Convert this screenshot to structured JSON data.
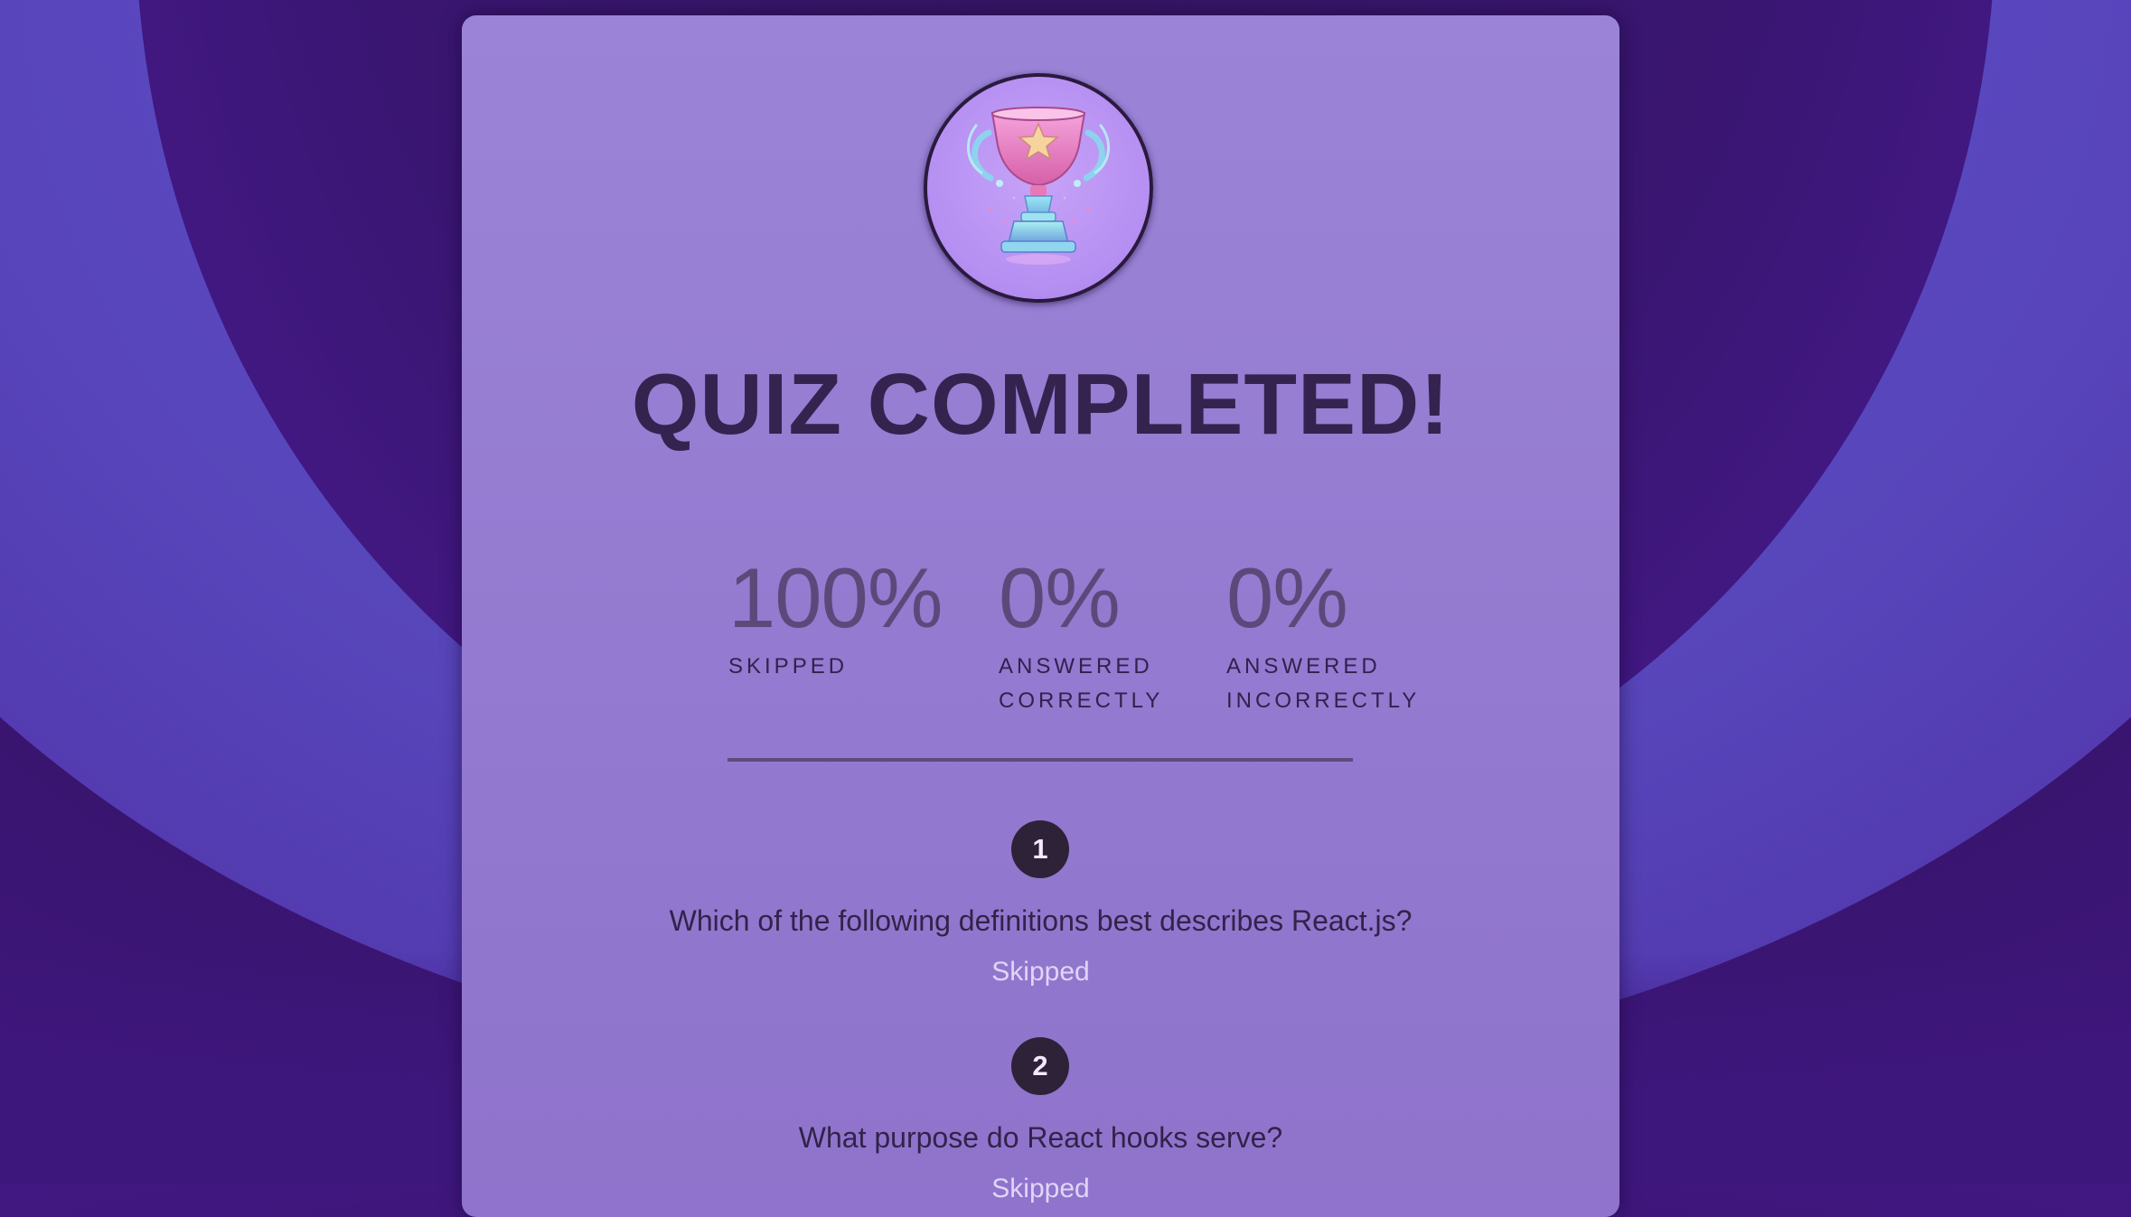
{
  "title": "QUIZ COMPLETED!",
  "stats": [
    {
      "value": "100%",
      "label_line1": "SKIPPED",
      "label_line2": ""
    },
    {
      "value": "0%",
      "label_line1": "ANSWERED",
      "label_line2": "CORRECTLY"
    },
    {
      "value": "0%",
      "label_line1": "ANSWERED",
      "label_line2": "INCORRECTLY"
    }
  ],
  "questions": [
    {
      "number": "1",
      "text": "Which of the following definitions best describes React.js?",
      "status": "Skipped"
    },
    {
      "number": "2",
      "text": "What purpose do React hooks serve?",
      "status": "Skipped"
    }
  ],
  "icons": {
    "trophy": "trophy-icon"
  },
  "colors": {
    "background": "#3b1574",
    "card": "#9379cf",
    "title": "#35234f",
    "skipped_text": "#e1d5f7",
    "number_badge": "#2d2237"
  }
}
